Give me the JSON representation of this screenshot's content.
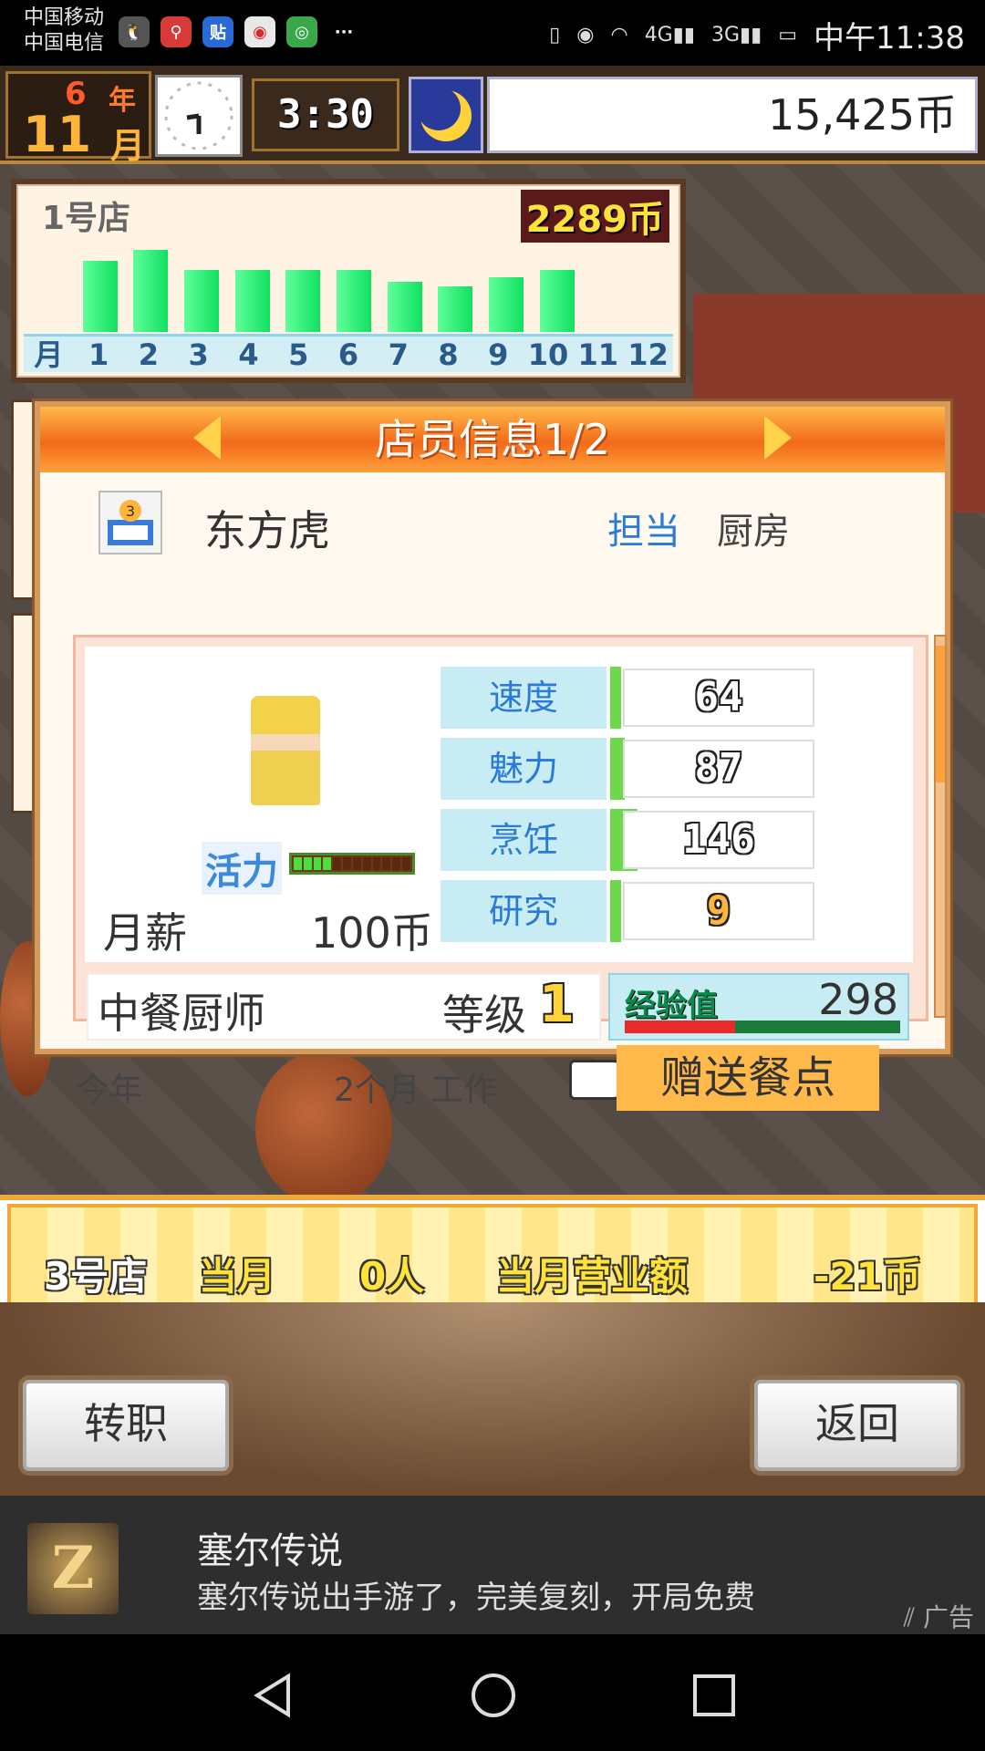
{
  "status_bar": {
    "carrier1": "中国移动",
    "carrier2": "中国电信",
    "more": "···",
    "net4g": "4G",
    "net3g": "3G",
    "time": "中午11:38"
  },
  "hud": {
    "year": "6",
    "year_label": "年",
    "month": "11",
    "month_label": "月",
    "time": "3:30",
    "money": "15,425币"
  },
  "store_panel": {
    "name": "1号店",
    "revenue": "2289币",
    "month_axis_label": "月"
  },
  "chart_data": {
    "type": "bar",
    "categories": [
      "1",
      "2",
      "3",
      "4",
      "5",
      "6",
      "7",
      "8",
      "9",
      "10",
      "11",
      "12"
    ],
    "values": [
      78,
      90,
      68,
      68,
      68,
      68,
      55,
      50,
      60,
      68,
      0,
      0
    ],
    "title": "1号店",
    "ylim": [
      0,
      100
    ]
  },
  "dialog": {
    "title": "店员信息1/2",
    "employee_name": "东方虎",
    "dept_label": "担当",
    "dept_value": "厨房",
    "vitality_label": "活力",
    "vitality_level": 0.3,
    "salary_label": "月薪",
    "salary_value": "100币",
    "stats": [
      {
        "label": "速度",
        "value": "64"
      },
      {
        "label": "魅力",
        "value": "87"
      },
      {
        "label": "烹饪",
        "value": "146"
      },
      {
        "label": "研究",
        "value": "9"
      }
    ],
    "job_title": "中餐厨师",
    "level_label": "等级",
    "level_value": "1",
    "exp_label": "经验值",
    "exp_value": "298",
    "exp_fill": 0.4,
    "year_label": "今年",
    "work_label": "2个月 工作",
    "gift_button": "赠送餐点"
  },
  "ticker": {
    "store": "3号店",
    "month_label": "当月",
    "count": "0人",
    "sales_label": "当月营业额",
    "sales_value": "-21币"
  },
  "buttons": {
    "transfer": "转职",
    "back": "返回"
  },
  "ad": {
    "title": "塞尔传说",
    "desc": "塞尔传说出手游了，完美复刻，开局免费",
    "tag": "广告",
    "icon_letter": "Z"
  },
  "colors": {
    "header_orange": "#f26a1a",
    "bar_green": "#10e060",
    "stat_label_bg": "#c8ecf4",
    "gift_bg": "#ffb84a"
  }
}
